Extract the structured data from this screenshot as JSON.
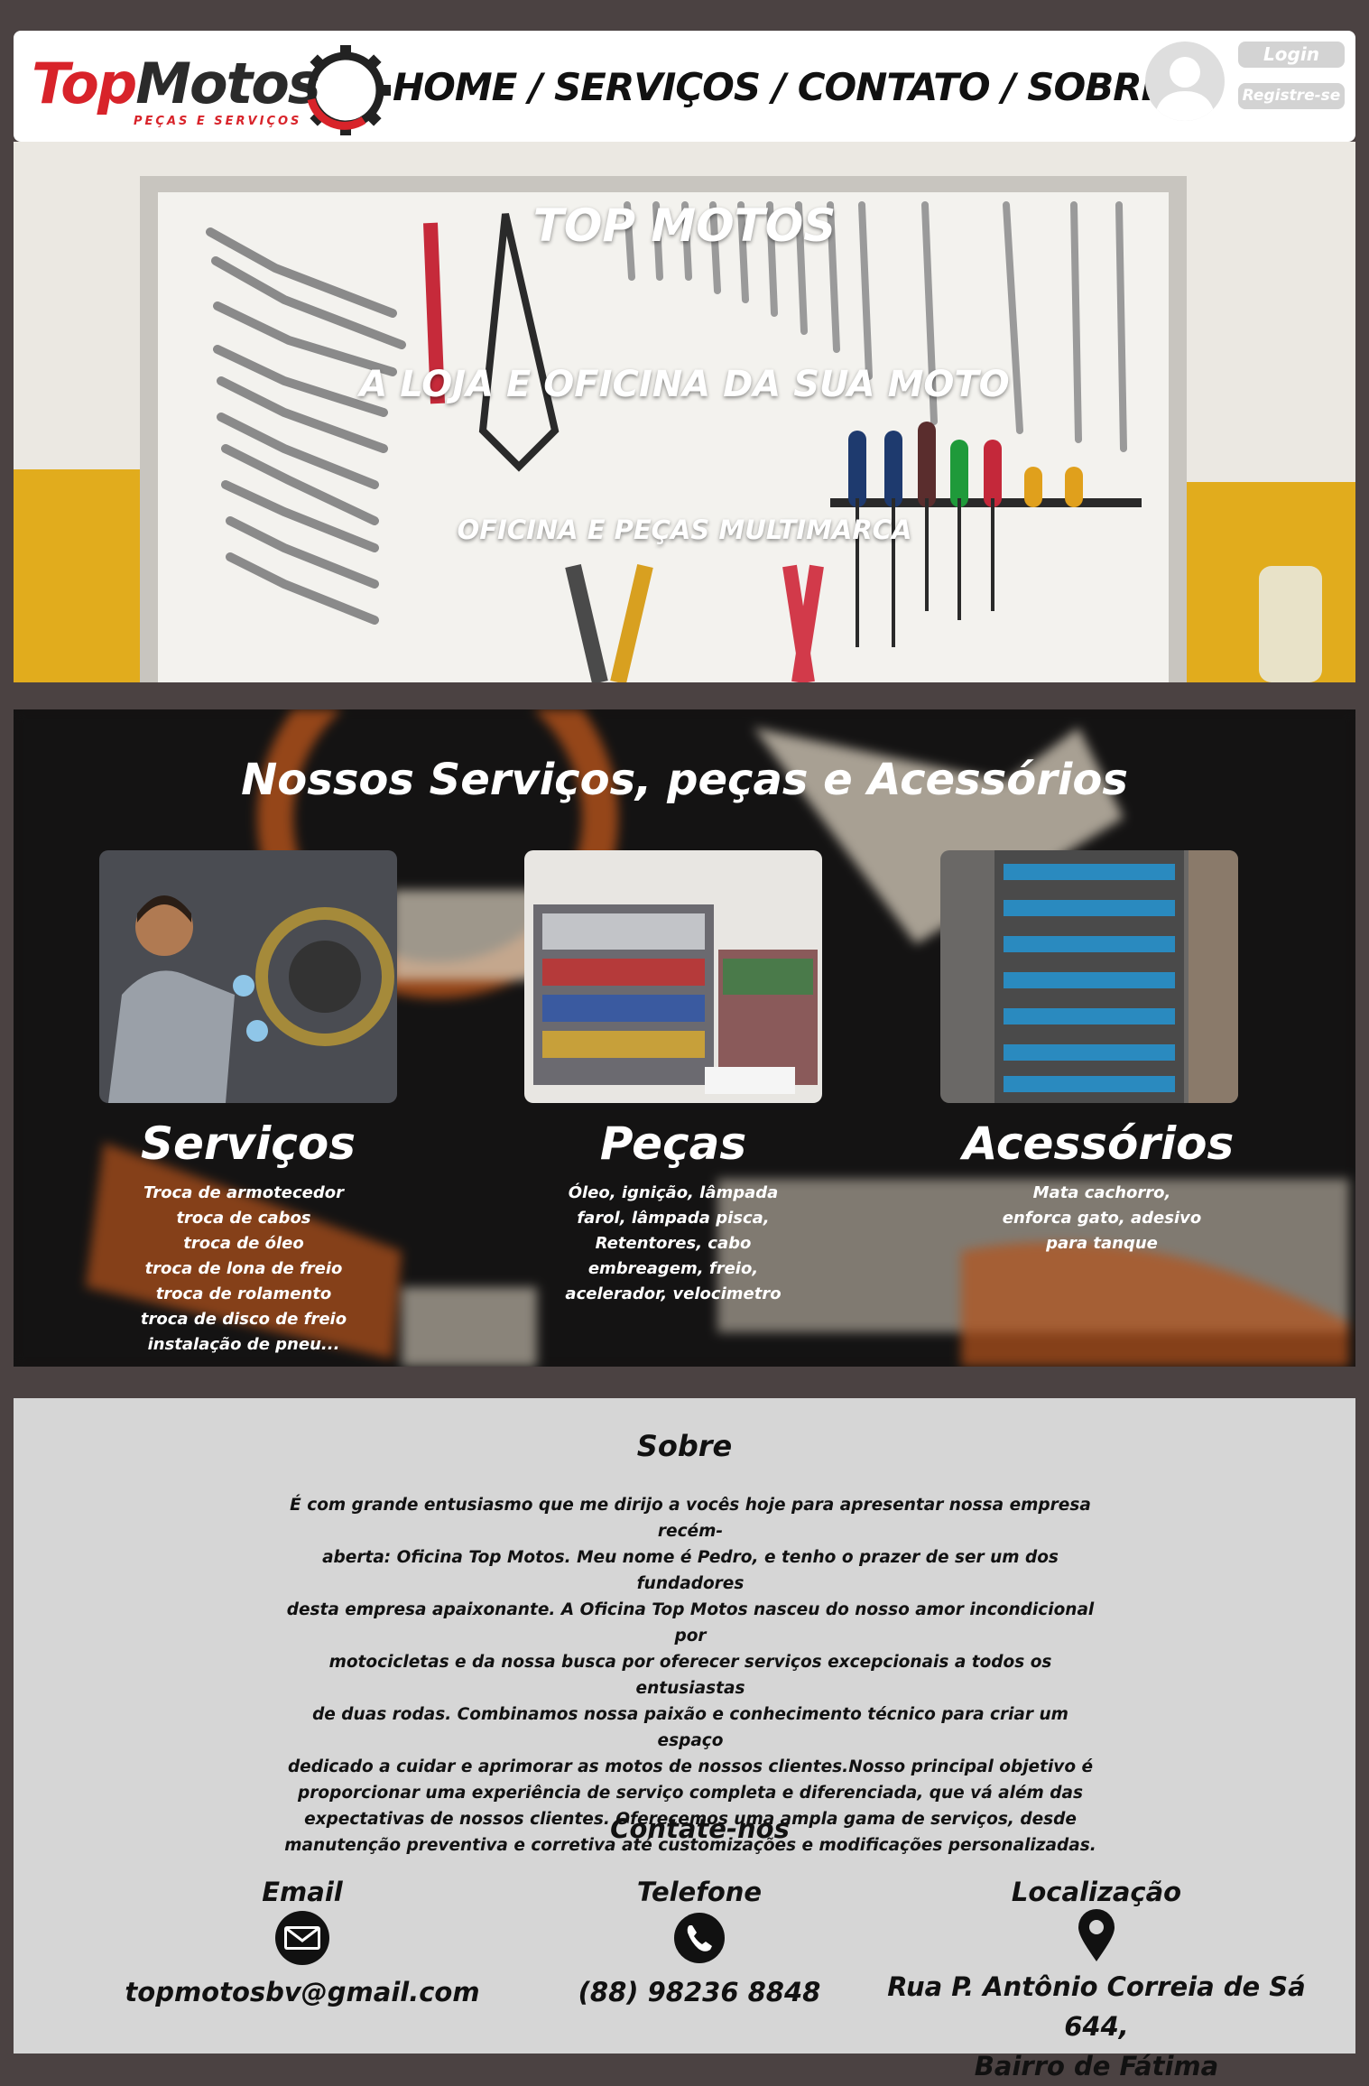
{
  "header": {
    "logo_top": "Top",
    "logo_motos": "Motos",
    "logo_sub": "PEÇAS E SERVIÇOS",
    "nav": [
      "HOME",
      "SERVIÇOS",
      "CONTATO",
      "SOBRE"
    ],
    "nav_separator": " / ",
    "login": "Login",
    "register": "Registre-se"
  },
  "hero": {
    "title": "TOP MOTOS",
    "subtitle": "A LOJA E OFICINA DA SUA MOTO",
    "tagline": "OFICINA E PEÇAS MULTIMARCA"
  },
  "services": {
    "title": "Nossos Serviços, peças e Acessórios",
    "cards": [
      {
        "heading": "Serviços",
        "lines": [
          "Troca de armotecedor",
          "troca de cabos",
          "troca de óleo",
          "troca de lona de freio",
          "troca de rolamento",
          "troca de disco de freio",
          "instalação de pneu..."
        ]
      },
      {
        "heading": "Peças",
        "lines": [
          "Óleo, ignição, lâmpada",
          "farol, lâmpada pisca,",
          "Retentores, cabo",
          "embreagem, freio,",
          "acelerador, velocimetro"
        ]
      },
      {
        "heading": "Acessórios",
        "lines": [
          "Mata cachorro,",
          "enforca gato, adesivo",
          "para tanque"
        ]
      }
    ]
  },
  "about": {
    "title": "Sobre",
    "lines": [
      "É com grande entusiasmo que me dirijo a vocês hoje para apresentar nossa empresa recém-",
      "aberta: Oficina Top Motos. Meu nome é Pedro, e tenho o prazer de ser um dos fundadores",
      "desta empresa apaixonante. A Oficina Top Motos nasceu do nosso amor incondicional por",
      "motocicletas e da nossa busca por oferecer serviços excepcionais a todos os entusiastas",
      "de duas rodas. Combinamos nossa paixão e conhecimento técnico para criar um espaço",
      "dedicado a cuidar e aprimorar as motos de nossos clientes.Nosso principal objetivo é",
      "proporcionar uma experiência de serviço completa e diferenciada, que vá além das",
      "expectativas de nossos clientes. Oferecemos uma ampla gama de serviços, desde",
      "manutenção preventiva e corretiva até customizações e modificações personalizadas."
    ]
  },
  "contact": {
    "title": "Contate-nos",
    "email_label": "Email",
    "email": "topmotosbv@gmail.com",
    "phone_label": "Telefone",
    "phone": "(88) 98236 8848",
    "location_label": "Localização",
    "address_line1": "Rua P. Antônio Correia de Sá 644,",
    "address_line2": "Bairro de Fátima"
  },
  "icons": {
    "email": "envelope-icon",
    "phone": "phone-icon",
    "location": "map-pin-icon",
    "avatar": "user-avatar-icon",
    "logo_gear": "gear-icon"
  },
  "colors": {
    "brand_red": "#d8232a",
    "page_bg": "#4b4242",
    "about_bg": "#d6d6d6"
  }
}
